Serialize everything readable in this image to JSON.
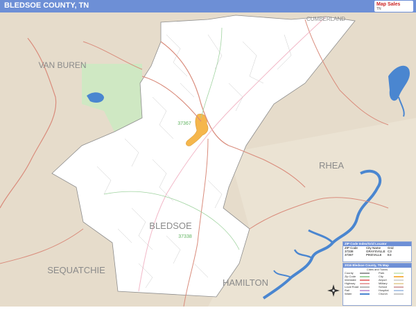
{
  "title": "BLEDSOE COUNTY, TN",
  "logo": {
    "line1": "Map Sales",
    "line2": "TN"
  },
  "neighbor_labels": {
    "cumberland": "CUMBERLAND",
    "van_buren": "VAN BUREN",
    "rhea": "RHEA",
    "sequatchie": "SEQUATCHIE",
    "hamilton": "HAMILTON",
    "bledsoe": "BLEDSOE"
  },
  "zip_labels": {
    "pikeville": "37367",
    "graysville": "37338"
  },
  "zip_box": {
    "title": "ZIP Code Index/Grid Locator",
    "header": [
      "ZIP Code",
      "City Name",
      "Grid"
    ],
    "rows": [
      [
        "37338",
        "GRAYSVILLE",
        "C3"
      ],
      [
        "37367",
        "PIKEVILLE",
        "E3"
      ]
    ]
  },
  "legend": {
    "title": "2016 Bledsoe County, TN Map",
    "subtitle": "Cities and Towns",
    "left_items": [
      {
        "label": "County",
        "color": "#9a9a9a"
      },
      {
        "label": "Zip Code",
        "color": "#9fd39f"
      },
      {
        "label": "Interstate",
        "color": "#e87c7c"
      },
      {
        "label": "Highway",
        "color": "#e9a4a4"
      },
      {
        "label": "Local Road",
        "color": "#b8b8b8"
      },
      {
        "label": "Rail",
        "color": "#c9a0d8"
      },
      {
        "label": "Water",
        "color": "#4a86d0"
      }
    ],
    "right_items": [
      {
        "label": "Park",
        "color": "#cfe8c3"
      },
      {
        "label": "City",
        "color": "#f5b64c"
      },
      {
        "label": "Airport",
        "color": "#d6d6d6"
      },
      {
        "label": "Military",
        "color": "#e8d7a8"
      },
      {
        "label": "School",
        "color": "#d8a9a9"
      },
      {
        "label": "Hospital",
        "color": "#b0c8e8"
      },
      {
        "label": "Church",
        "color": "#c8c8c8"
      }
    ]
  },
  "colors": {
    "title_bar": "#6d8fd6",
    "outside": "#e6dccb",
    "county": "#ffffff",
    "park": "#cfe8c3",
    "water": "#4a86d0",
    "city": "#f5b64c",
    "highway": "#d98b7b",
    "zip": "#9fd39f"
  }
}
